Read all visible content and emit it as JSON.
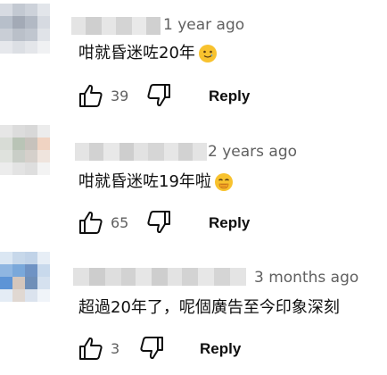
{
  "comments": [
    {
      "timestamp": "1 year ago",
      "text": "咁就昏迷咗20年",
      "emoji": "slightly-smiling-face-with-tear",
      "likes": "39",
      "reply_label": "Reply"
    },
    {
      "timestamp": "2 years ago",
      "text": "咁就昏迷咗19年啦",
      "emoji": "face-with-hand-over-mouth",
      "likes": "65",
      "reply_label": "Reply"
    },
    {
      "timestamp": "3 months ago",
      "text": "超過20年了，呢個廣告至今印象深刻",
      "emoji": "",
      "likes": "3",
      "reply_label": "Reply"
    }
  ],
  "colors": {
    "text_primary": "#0f0f0f",
    "text_secondary": "#606060",
    "emoji_yellow": "#f8c22e"
  }
}
